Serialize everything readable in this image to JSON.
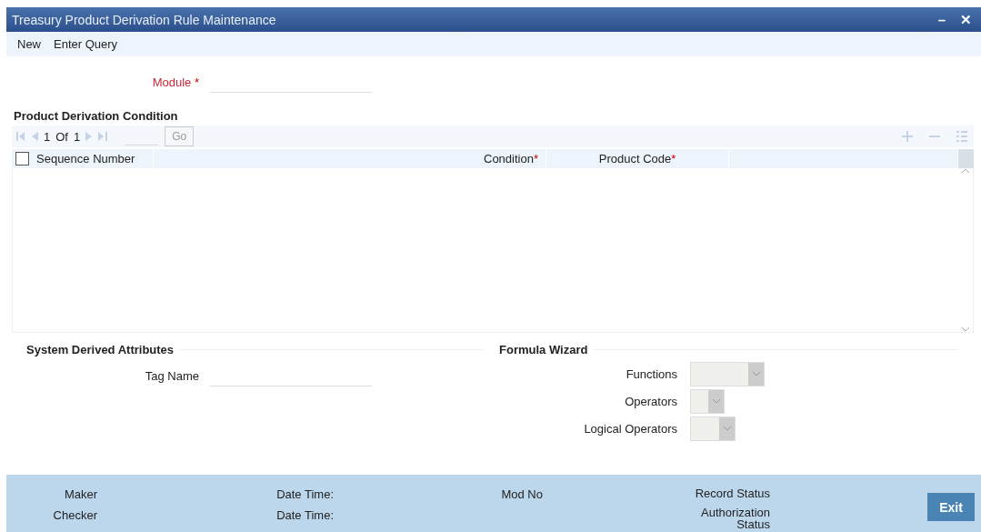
{
  "window": {
    "title": "Treasury Product Derivation Rule Maintenance",
    "minimize": "–",
    "close": "✕"
  },
  "menu": [
    {
      "label": "New"
    },
    {
      "label": "Enter Query"
    }
  ],
  "module": {
    "label": "Module",
    "required_mark": "*"
  },
  "condition_section": {
    "title": "Product Derivation Condition",
    "pager": {
      "current": "1",
      "of": "Of",
      "total": "1",
      "go": "Go"
    },
    "columns": [
      {
        "label": "Sequence Number"
      },
      {
        "label": "Condition",
        "mark": "*"
      },
      {
        "label": "Product Code",
        "mark": "*"
      }
    ],
    "select_all": {
      "checked": false
    }
  },
  "system_section": {
    "title": "System Derived Attributes",
    "fields": [
      {
        "label": "Tag Name"
      }
    ]
  },
  "formula_section": {
    "title": "Formula Wizard",
    "dropdowns": [
      {
        "label": "Functions"
      },
      {
        "label": "Operators"
      },
      {
        "label": "Logical Operators"
      }
    ]
  },
  "footer": {
    "columns": [
      [
        "Maker",
        "Checker"
      ],
      [
        "Date Time:",
        "Date Time:"
      ],
      [
        "Mod No"
      ],
      [
        "Record Status",
        "Authorization Status"
      ]
    ],
    "exit": "Exit"
  }
}
